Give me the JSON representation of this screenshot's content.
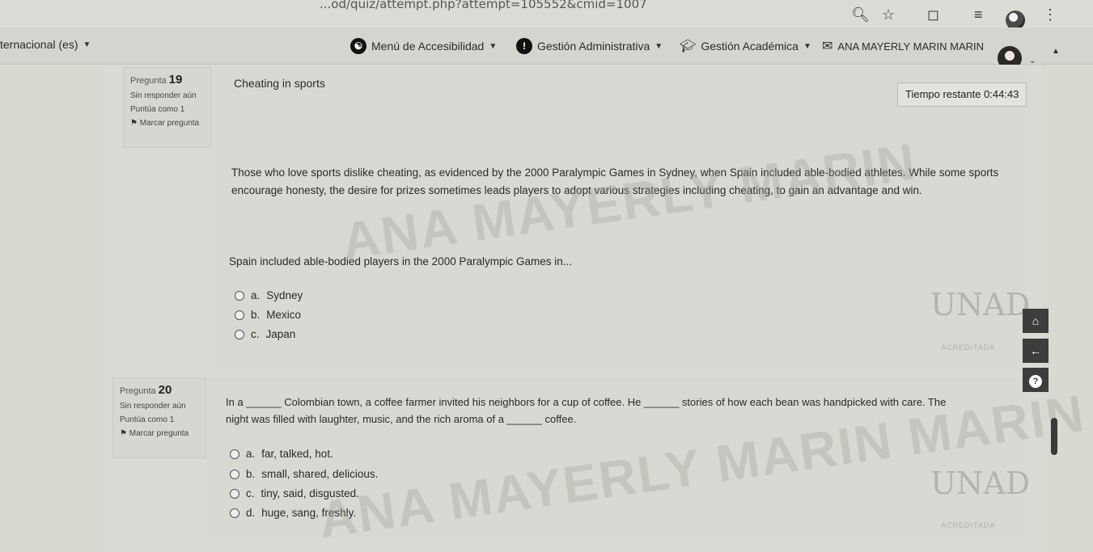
{
  "browser": {
    "url": "...od/quiz/attempt.php?attempt=105552&cmid=1007",
    "icons": [
      "search-icon",
      "star-icon",
      "extension-icon",
      "reading-list-icon",
      "profile-icon",
      "menu-icon"
    ]
  },
  "navbar": {
    "language": "ternacional (es)",
    "accessibility_menu": "Menú de Accesibilidad",
    "admin_menu": "Gestión Administrativa",
    "academic_menu": "Gestión Académica",
    "user_name": "ANA MAYERLY MARIN MARIN"
  },
  "timer": {
    "label": "Tiempo restante",
    "value": "0:44:43"
  },
  "questions": [
    {
      "label": "Pregunta",
      "number": "19",
      "status": "Sin responder aún",
      "score": "Puntúa como 1",
      "flag": "Marcar pregunta",
      "title": "Cheating in sports",
      "passage": "Those who love sports dislike cheating, as evidenced by the 2000 Paralympic Games in Sydney, when Spain included able-bodied athletes. While some sports encourage honesty, the desire for prizes sometimes leads players to adopt various strategies including cheating, to gain an advantage and win.",
      "prompt": "Spain included able-bodied players in the 2000 Paralympic Games in...",
      "options": [
        {
          "letter": "a.",
          "text": "Sydney"
        },
        {
          "letter": "b.",
          "text": "Mexico"
        },
        {
          "letter": "c.",
          "text": "Japan"
        }
      ]
    },
    {
      "label": "Pregunta",
      "number": "20",
      "status": "Sin responder aún",
      "score": "Puntúa como 1",
      "flag": "Marcar pregunta",
      "line1": "In a ______ Colombian town, a coffee farmer invited his neighbors for a cup of coffee. He ______ stories of how each bean was handpicked with care. The",
      "line2": "night was filled with laughter, music, and the rich aroma of a ______ coffee.",
      "options": [
        {
          "letter": "a.",
          "text": "far, talked, hot."
        },
        {
          "letter": "b.",
          "text": "small, shared, delicious."
        },
        {
          "letter": "c.",
          "text": "tiny, said, disgusted."
        },
        {
          "letter": "d.",
          "text": "huge, sang, freshly."
        }
      ]
    }
  ],
  "watermark": {
    "text1": "ANA MAYERLY MARIN",
    "text2": "ANA MAYERLY MARIN MARIN",
    "logo": "UNAD",
    "logo_sub": "ACREDITADA"
  },
  "colors": {
    "background": "#d9d9d2",
    "panel": "#dadbd4",
    "float_button": "#3d3d3d"
  }
}
